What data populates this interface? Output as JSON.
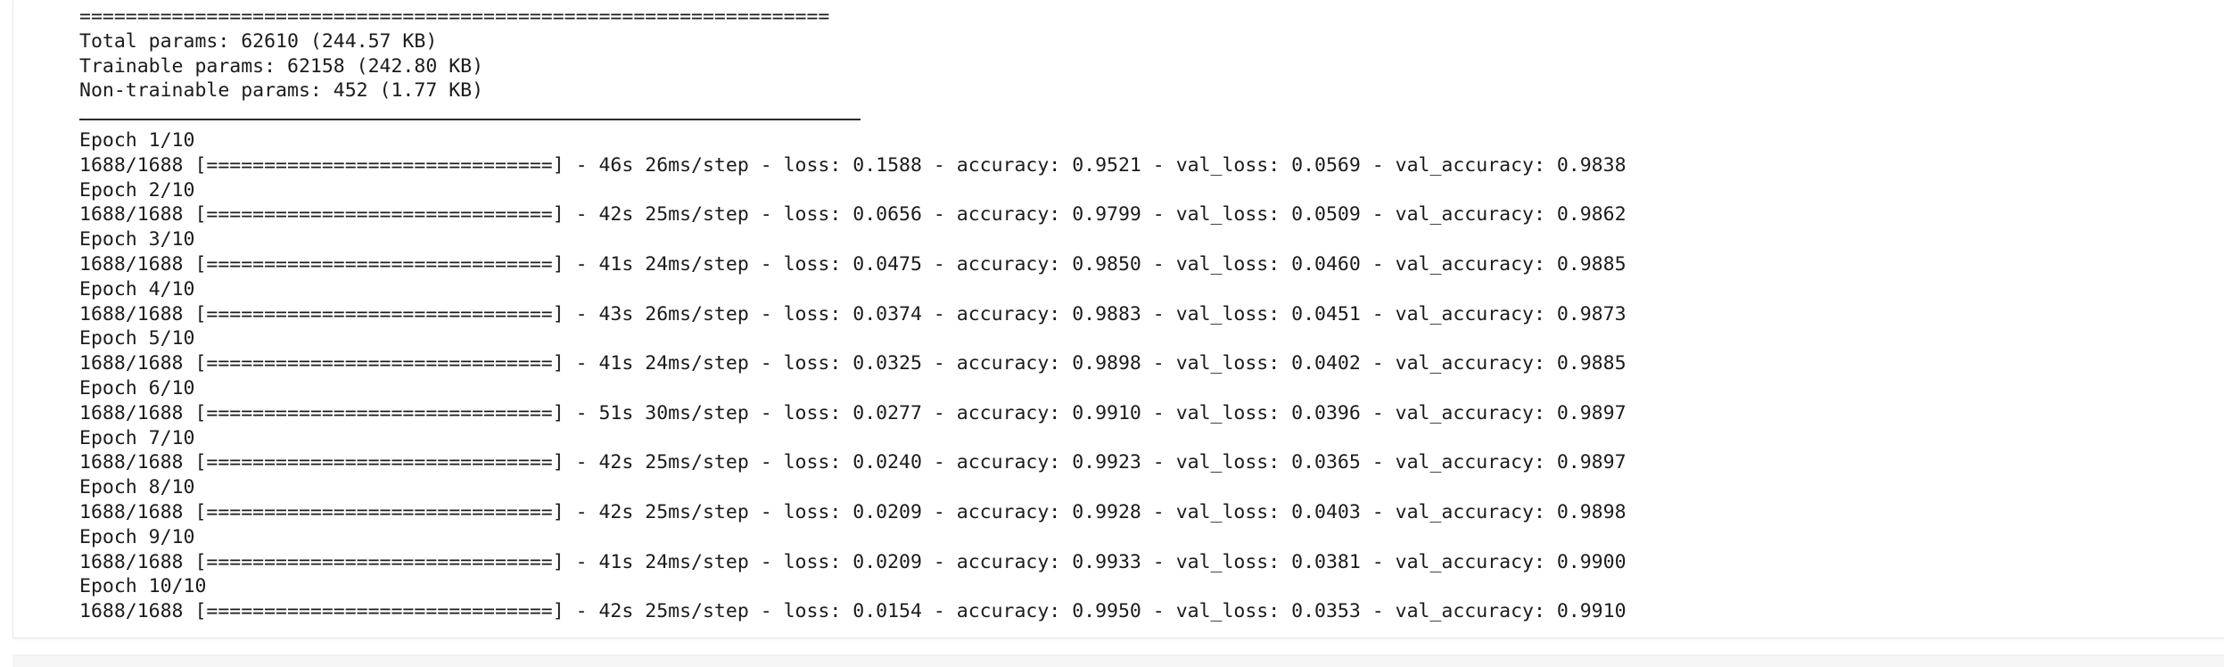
{
  "output": {
    "separator_double": "=================================================================",
    "summary": {
      "total_params": "Total params: 62610 (244.57 KB)",
      "trainable_params": "Trainable params: 62158 (242.80 KB)",
      "non_trainable_params": "Non-trainable params: 452 (1.77 KB)"
    },
    "epochs": [
      {
        "header": "Epoch 1/10",
        "progress": "1688/1688 [==============================] - 46s 26ms/step - loss: 0.1588 - accuracy: 0.9521 - val_loss: 0.0569 - val_accuracy: 0.9838"
      },
      {
        "header": "Epoch 2/10",
        "progress": "1688/1688 [==============================] - 42s 25ms/step - loss: 0.0656 - accuracy: 0.9799 - val_loss: 0.0509 - val_accuracy: 0.9862"
      },
      {
        "header": "Epoch 3/10",
        "progress": "1688/1688 [==============================] - 41s 24ms/step - loss: 0.0475 - accuracy: 0.9850 - val_loss: 0.0460 - val_accuracy: 0.9885"
      },
      {
        "header": "Epoch 4/10",
        "progress": "1688/1688 [==============================] - 43s 26ms/step - loss: 0.0374 - accuracy: 0.9883 - val_loss: 0.0451 - val_accuracy: 0.9873"
      },
      {
        "header": "Epoch 5/10",
        "progress": "1688/1688 [==============================] - 41s 24ms/step - loss: 0.0325 - accuracy: 0.9898 - val_loss: 0.0402 - val_accuracy: 0.9885"
      },
      {
        "header": "Epoch 6/10",
        "progress": "1688/1688 [==============================] - 51s 30ms/step - loss: 0.0277 - accuracy: 0.9910 - val_loss: 0.0396 - val_accuracy: 0.9897"
      },
      {
        "header": "Epoch 7/10",
        "progress": "1688/1688 [==============================] - 42s 25ms/step - loss: 0.0240 - accuracy: 0.9923 - val_loss: 0.0365 - val_accuracy: 0.9897"
      },
      {
        "header": "Epoch 8/10",
        "progress": "1688/1688 [==============================] - 42s 25ms/step - loss: 0.0209 - accuracy: 0.9928 - val_loss: 0.0403 - val_accuracy: 0.9898"
      },
      {
        "header": "Epoch 9/10",
        "progress": "1688/1688 [==============================] - 41s 24ms/step - loss: 0.0209 - accuracy: 0.9933 - val_loss: 0.0381 - val_accuracy: 0.9900"
      },
      {
        "header": "Epoch 10/10",
        "progress": "1688/1688 [==============================] - 42s 25ms/step - loss: 0.0154 - accuracy: 0.9950 - val_loss: 0.0353 - val_accuracy: 0.9910"
      }
    ]
  },
  "colors": {
    "text": "#1b1b1b",
    "background": "#ffffff",
    "next_cell_background": "#f5f5f5"
  }
}
